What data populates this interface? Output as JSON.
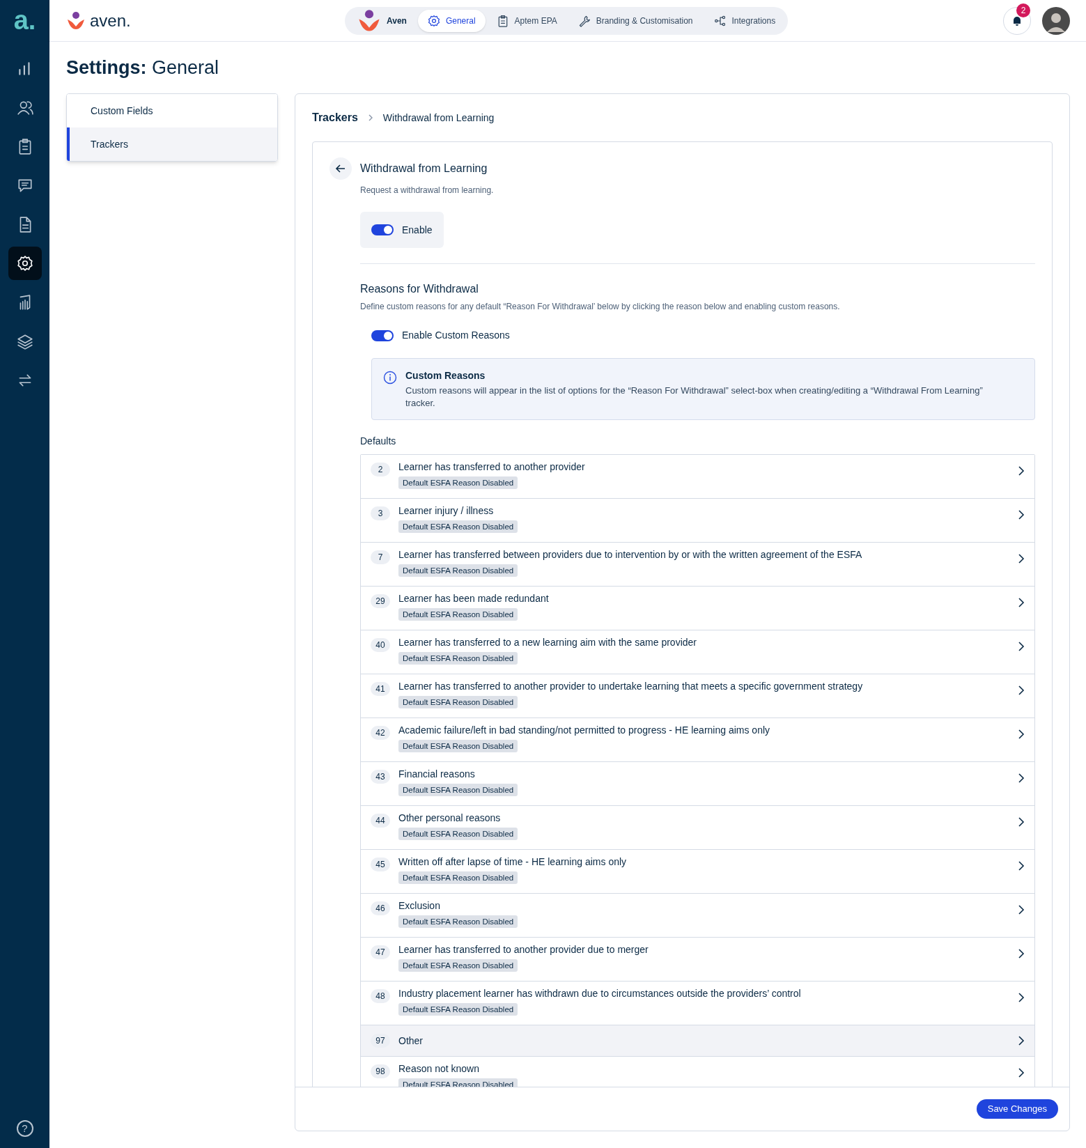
{
  "rail": {
    "logo": "a.",
    "items": [
      {
        "kind": "chart",
        "selected": false
      },
      {
        "kind": "users",
        "selected": false
      },
      {
        "kind": "clipboard",
        "selected": false
      },
      {
        "kind": "chat",
        "selected": false
      },
      {
        "kind": "document",
        "selected": false
      },
      {
        "kind": "gear",
        "selected": true
      },
      {
        "kind": "report",
        "selected": false
      },
      {
        "kind": "layers",
        "selected": false
      },
      {
        "kind": "swap",
        "selected": false
      }
    ],
    "help": "?"
  },
  "topbar": {
    "brand": "aven.",
    "tabs": [
      {
        "label": "Aven",
        "kind": "logo",
        "selected": false
      },
      {
        "label": "General",
        "kind": "gear",
        "selected": true
      },
      {
        "label": "Aptem EPA",
        "kind": "clipboard",
        "selected": false
      },
      {
        "label": "Branding & Customisation",
        "kind": "wrench",
        "selected": false
      },
      {
        "label": "Integrations",
        "kind": "nodes",
        "selected": false
      }
    ],
    "notifications": "2"
  },
  "page_title": {
    "bold": "Settings:",
    "rest": "General"
  },
  "settings_menu": [
    {
      "label": "Custom Fields",
      "selected": false
    },
    {
      "label": "Trackers",
      "selected": true
    }
  ],
  "breadcrumb": [
    "Trackers",
    "Withdrawal from Learning"
  ],
  "tracker": {
    "title": "Withdrawal from Learning",
    "description": "Request a withdrawal from learning.",
    "enable": {
      "label": "Enable",
      "on": true
    }
  },
  "reasons": {
    "title": "Reasons for Withdrawal",
    "description": "Define custom reasons for any default “Reason For Withdrawal’ below by clicking the reason  below and enabling custom reasons.",
    "toggle": {
      "label": "Enable Custom Reasons",
      "on": true
    },
    "info": {
      "title": "Custom Reasons",
      "text": "Custom reasons will appear in the list of options for the “Reason For Withdrawal” select-box when creating/editing a “Withdrawal From Learning” tracker."
    },
    "defaults_label": "Defaults",
    "rows": [
      {
        "code": "2",
        "title": "Learner has transferred to another provider",
        "badge": "Default ESFA Reason Disabled",
        "highlighted": false
      },
      {
        "code": "3",
        "title": "Learner injury / illness",
        "badge": "Default ESFA Reason Disabled",
        "highlighted": false
      },
      {
        "code": "7",
        "title": "Learner has transferred between providers due to intervention by or with the written agreement of the ESFA",
        "badge": "Default ESFA Reason Disabled",
        "highlighted": false
      },
      {
        "code": "29",
        "title": "Learner has been made redundant",
        "badge": "Default ESFA Reason Disabled",
        "highlighted": false
      },
      {
        "code": "40",
        "title": "Learner has transferred to a new learning aim with the same provider",
        "badge": "Default ESFA Reason Disabled",
        "highlighted": false
      },
      {
        "code": "41",
        "title": "Learner has transferred to another provider to undertake learning that meets a specific government strategy",
        "badge": "Default ESFA Reason Disabled",
        "highlighted": false
      },
      {
        "code": "42",
        "title": "Academic failure/left in bad standing/not permitted to progress - HE learning aims only",
        "badge": "Default ESFA Reason Disabled",
        "highlighted": false
      },
      {
        "code": "43",
        "title": "Financial reasons",
        "badge": "Default ESFA Reason Disabled",
        "highlighted": false
      },
      {
        "code": "44",
        "title": "Other personal reasons",
        "badge": "Default ESFA Reason Disabled",
        "highlighted": false
      },
      {
        "code": "45",
        "title": "Written off after lapse of time - HE learning aims only",
        "badge": "Default ESFA Reason Disabled",
        "highlighted": false
      },
      {
        "code": "46",
        "title": "Exclusion",
        "badge": "Default ESFA Reason Disabled",
        "highlighted": false
      },
      {
        "code": "47",
        "title": "Learner has transferred to another provider due to merger",
        "badge": "Default ESFA Reason Disabled",
        "highlighted": false
      },
      {
        "code": "48",
        "title": "Industry placement learner has withdrawn due to circumstances outside the providers’ control",
        "badge": "Default ESFA Reason Disabled",
        "highlighted": false
      },
      {
        "code": "97",
        "title": "Other",
        "highlighted": true
      },
      {
        "code": "98",
        "title": "Reason not known",
        "badge": "Default ESFA Reason Disabled",
        "highlighted": false
      }
    ]
  },
  "save_button": "Save Changes"
}
